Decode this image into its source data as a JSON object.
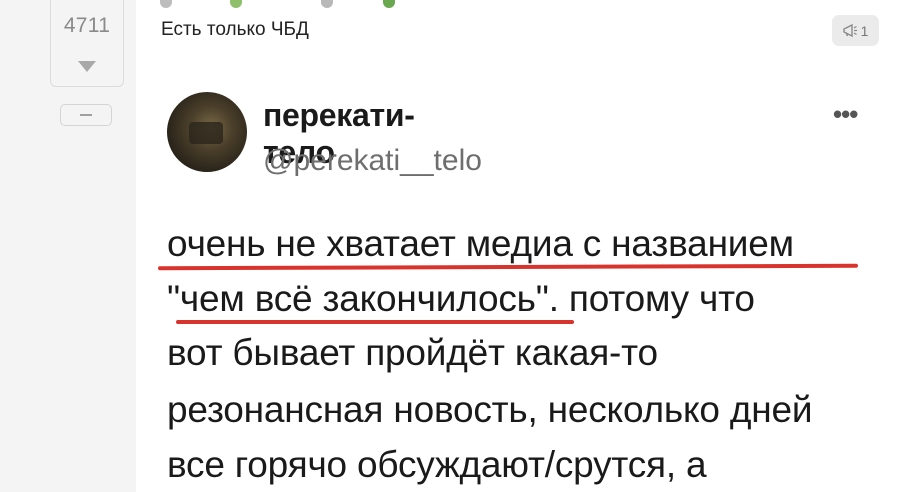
{
  "vote": {
    "count": "4711"
  },
  "comment": {
    "text": "Есть только ЧБД",
    "badge_count": "1"
  },
  "tweet": {
    "display_name": "перекати-тело",
    "handle": "@perekati__telo",
    "more": "•••",
    "lines": [
      "очень не хватает медиа с названием",
      "\"чем всё закончилось\". потому что",
      "вот бывает пройдёт какая-то",
      "резонансная новость, несколько дней",
      "все горячо обсуждают/срутся, а"
    ]
  },
  "colors": {
    "underline": "#d8332c",
    "gutter": "#f4f4f4"
  },
  "icons": {
    "badge_icon": "megaphone-icon",
    "vote_down": "arrow-down-icon",
    "collapse": "minus-icon"
  }
}
